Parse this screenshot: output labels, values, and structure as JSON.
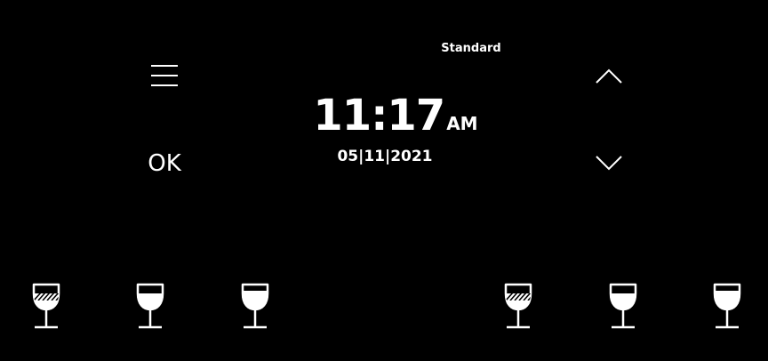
{
  "header": {
    "mode": "Standard"
  },
  "controls": {
    "menu_icon": "hamburger-menu-icon",
    "ok_label": "OK",
    "up_icon": "chevron-up-icon",
    "down_icon": "chevron-down-icon"
  },
  "clock": {
    "time": "11:17",
    "ampm": "AM",
    "date": "05|11|2021"
  },
  "zones": {
    "left": [
      {
        "icon": "wine-glass-hatched-icon",
        "fill": "hatched"
      },
      {
        "icon": "wine-glass-filled-icon",
        "fill": "full"
      },
      {
        "icon": "wine-glass-partial-icon",
        "fill": "partial"
      }
    ],
    "right": [
      {
        "icon": "wine-glass-hatched-icon",
        "fill": "hatched"
      },
      {
        "icon": "wine-glass-filled-icon",
        "fill": "full"
      },
      {
        "icon": "wine-glass-partial-icon",
        "fill": "partial"
      }
    ]
  },
  "colors": {
    "background": "#000000",
    "foreground": "#ffffff"
  }
}
